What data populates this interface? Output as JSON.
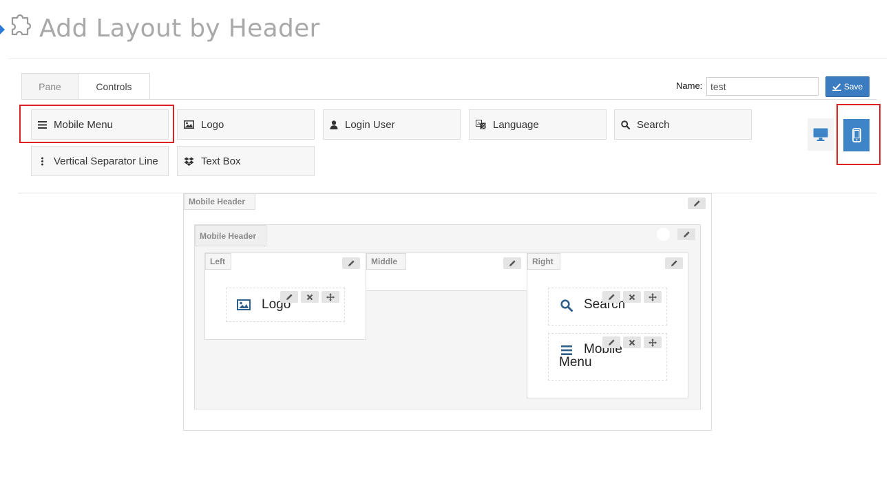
{
  "page": {
    "title": "Add Layout by Header"
  },
  "tabs": [
    {
      "label": "Pane",
      "active": false
    },
    {
      "label": "Controls",
      "active": true
    }
  ],
  "form": {
    "name_label": "Name:",
    "name_value": "test",
    "save_label": "Save"
  },
  "controls": [
    {
      "label": "Mobile Menu",
      "icon": "bars-icon"
    },
    {
      "label": "Logo",
      "icon": "image-icon"
    },
    {
      "label": "Login User",
      "icon": "user-icon"
    },
    {
      "label": "Language",
      "icon": "translate-icon"
    },
    {
      "label": "Search",
      "icon": "search-icon"
    },
    {
      "label": "Vertical Separator Line",
      "icon": "vertical-dots-icon"
    },
    {
      "label": "Text Box",
      "icon": "dropbox-icon"
    }
  ],
  "devices": {
    "desktop_icon": "desktop-icon",
    "mobile_icon": "mobile-icon",
    "active": "mobile"
  },
  "layout": {
    "outer_label": "Mobile Header",
    "inner_label": "Mobile Header",
    "columns": {
      "left": "Left",
      "middle": "Middle",
      "right": "Right"
    },
    "widgets": {
      "logo": "Logo",
      "search": "Search",
      "mobile_menu": "Mobile Menu"
    }
  },
  "colors": {
    "accent": "#3d85c6",
    "highlight": "#e02020",
    "widget_icon": "#2e5f8a"
  }
}
